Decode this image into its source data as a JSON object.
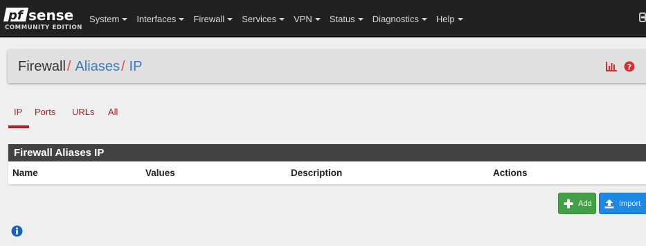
{
  "app": {
    "brand_sub": "COMMUNITY EDITION"
  },
  "nav": {
    "items": [
      {
        "label": "System",
        "icon": "caret-down-icon"
      },
      {
        "label": "Interfaces",
        "icon": "caret-down-icon"
      },
      {
        "label": "Firewall",
        "icon": "caret-down-icon"
      },
      {
        "label": "Services",
        "icon": "caret-down-icon"
      },
      {
        "label": "VPN",
        "icon": "caret-down-icon"
      },
      {
        "label": "Status",
        "icon": "caret-down-icon"
      },
      {
        "label": "Diagnostics",
        "icon": "caret-down-icon"
      },
      {
        "label": "Help",
        "icon": "caret-down-icon"
      }
    ],
    "logout_icon": "logout-icon"
  },
  "breadcrumb": {
    "items": [
      {
        "label": "Firewall"
      },
      {
        "label": "Aliases"
      },
      {
        "label": "IP"
      }
    ],
    "separator": "/",
    "actions": [
      "chart-icon",
      "help-icon"
    ]
  },
  "tabs": {
    "items": [
      {
        "label": "IP",
        "active": true
      },
      {
        "label": "Ports",
        "active": false
      },
      {
        "label": "URLs",
        "active": false
      },
      {
        "label": "All",
        "active": false
      }
    ]
  },
  "table": {
    "title": "Firewall Aliases IP",
    "columns": [
      "Name",
      "Values",
      "Description",
      "Actions"
    ],
    "rows": []
  },
  "buttons": {
    "add_label": "Add",
    "import_label": "Import"
  },
  "colors": {
    "navbar": "#212121",
    "accent_red": "#b71c1c",
    "link_blue": "#3b7bbf",
    "add_green": "#43a047",
    "import_blue": "#1e88e5"
  }
}
